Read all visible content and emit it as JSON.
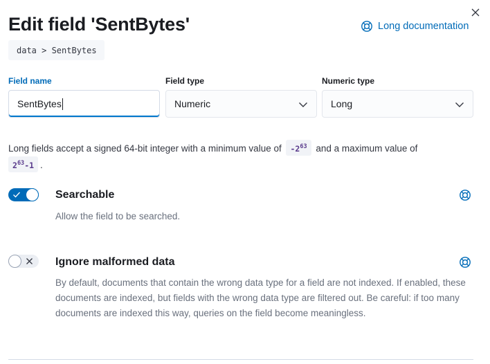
{
  "flyout": {
    "title": "Edit field 'SentBytes'",
    "docs_link_label": "Long documentation",
    "breadcrumb": "data > SentBytes"
  },
  "form": {
    "field_name": {
      "label": "Field name",
      "value": "SentBytes"
    },
    "field_type": {
      "label": "Field type",
      "value": "Numeric"
    },
    "numeric_type": {
      "label": "Numeric type",
      "value": "Long"
    }
  },
  "info": {
    "text_before": "Long fields accept a signed 64-bit integer with a minimum value of",
    "min_base": "-2",
    "min_exp": "63",
    "text_middle": "and a maximum value of",
    "max_base": "2",
    "max_exp": "63",
    "max_suffix": "-1",
    "text_end": "."
  },
  "parameters": {
    "searchable": {
      "title": "Searchable",
      "description": "Allow the field to be searched.",
      "enabled": true
    },
    "ignore_malformed": {
      "title": "Ignore malformed data",
      "description": "By default, documents that contain the wrong data type for a field are not indexed. If enabled, these documents are indexed, but fields with the wrong data type are filtered out. Be careful: if too many documents are indexed this way, queries on the field become meaningless.",
      "enabled": false
    }
  },
  "colors": {
    "accent": "#006bb8",
    "code_text": "#5a3b8c",
    "focus_underline": "#0077cc"
  },
  "icons": {
    "close": "close-icon",
    "docs": "lifebuoy-icon",
    "select": "chevron-down-icon",
    "switch_on": "check-icon",
    "switch_off": "cross-icon"
  }
}
